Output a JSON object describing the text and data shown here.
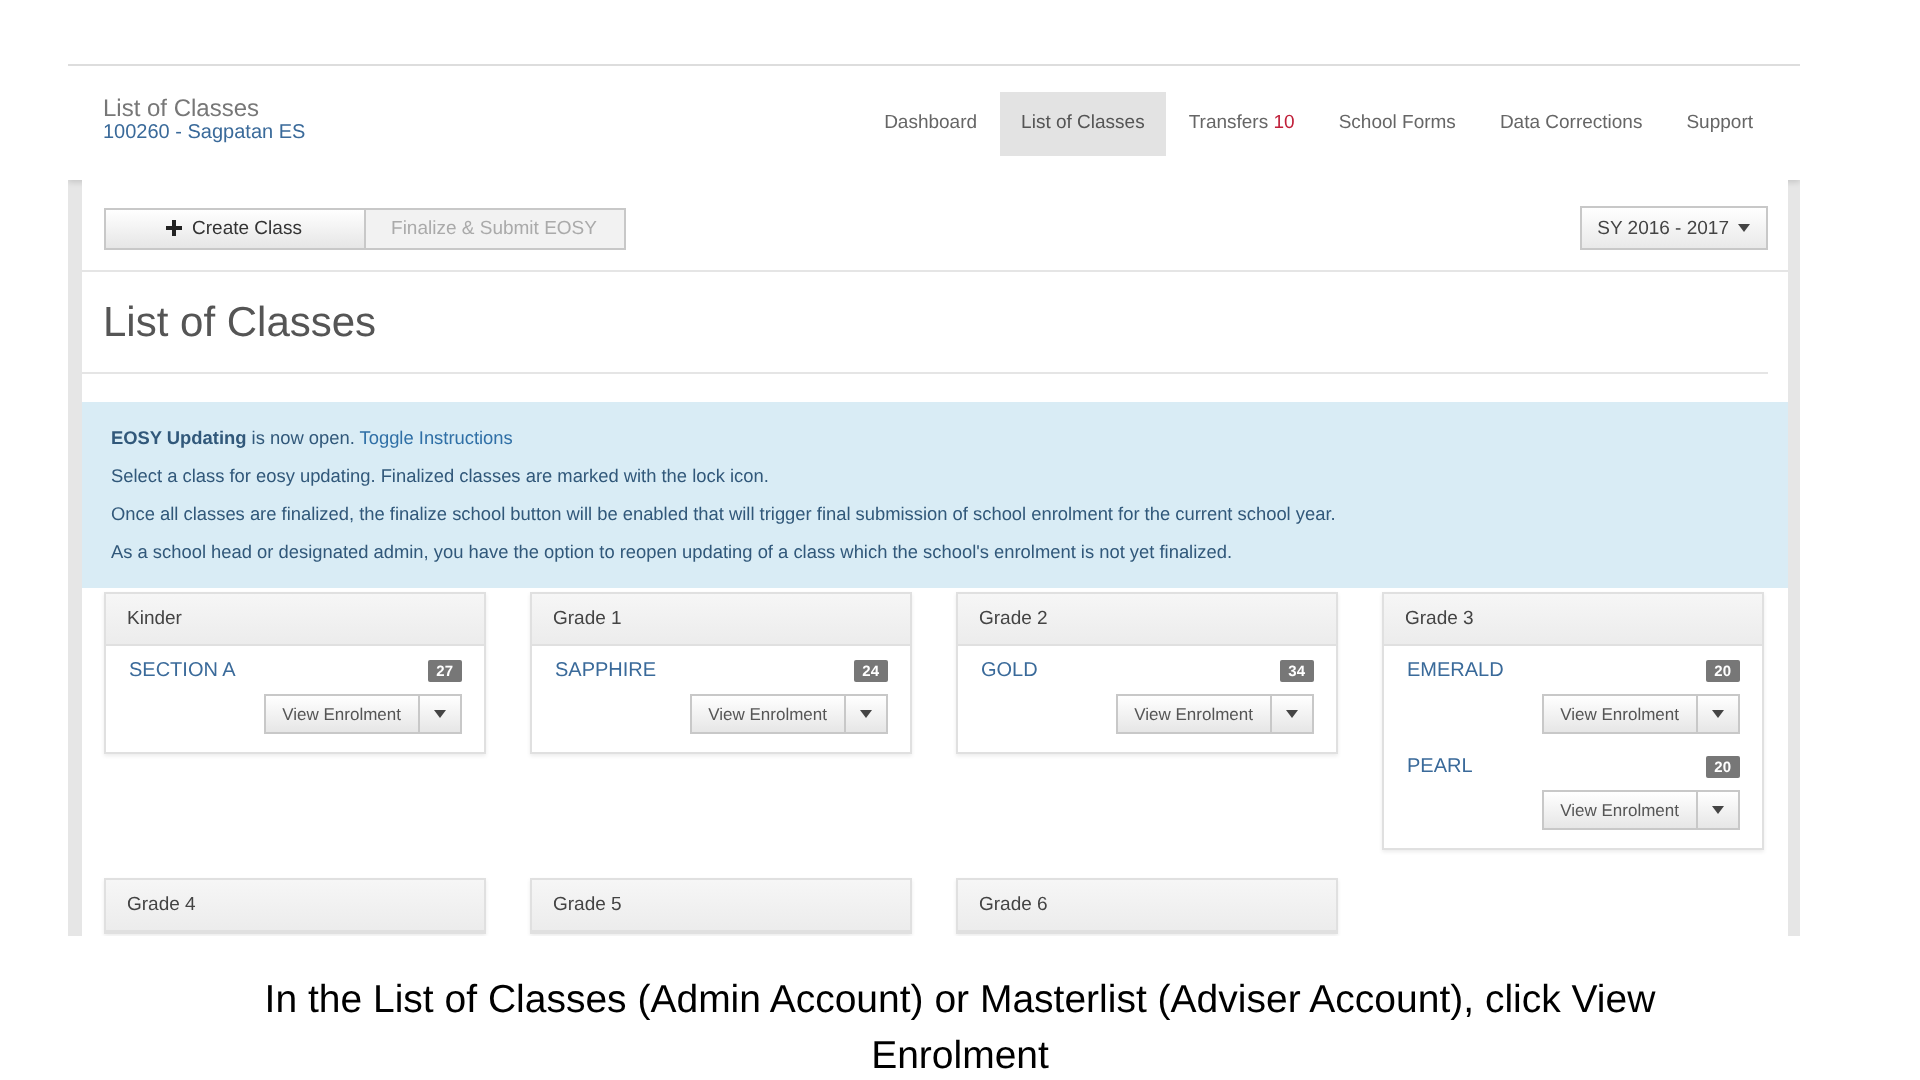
{
  "header": {
    "title": "List of Classes",
    "school": "100260 - Sagpatan ES"
  },
  "nav": [
    {
      "label": "Dashboard",
      "selected": false
    },
    {
      "label": "List of Classes",
      "selected": true
    },
    {
      "label": "Transfers",
      "count": "10",
      "selected": false
    },
    {
      "label": "School Forms",
      "selected": false
    },
    {
      "label": "Data Corrections",
      "selected": false
    },
    {
      "label": "Support",
      "selected": false
    }
  ],
  "toolbar": {
    "buttons": [
      {
        "label": "Create Class",
        "disabled": false
      },
      {
        "label": "Finalize & Submit EOSY",
        "disabled": true
      }
    ],
    "school_year": "SY 2016 - 2017"
  },
  "heading": "List of Classes",
  "alert": {
    "lead": "**EOSY Updating** is now open.",
    "link": "Toggle Instructions",
    "lines": [
      "Select a class for eosy updating. Finalized classes are marked with the lock icon.",
      "Once all classes are finalized, the finalize school button will be enabled that will trigger final submission of school enrolment for the current school year.",
      "As a school head or designated admin, you have the option to reopen updating of a class which the school's enrolment is not yet finalized."
    ]
  },
  "grades": [
    {
      "name": "Kinder",
      "sections": [
        {
          "name": "SECTION A",
          "count": "27",
          "button": "View Enrolment"
        }
      ]
    },
    {
      "name": "Grade 1",
      "sections": [
        {
          "name": "SAPPHIRE",
          "count": "24",
          "button": "View Enrolment"
        }
      ]
    },
    {
      "name": "Grade 2",
      "sections": [
        {
          "name": "GOLD",
          "count": "34",
          "button": "View Enrolment"
        }
      ]
    },
    {
      "name": "Grade 3",
      "sections": [
        {
          "name": "EMERALD",
          "count": "20",
          "button": "View Enrolment"
        },
        {
          "name": "PEARL",
          "count": "20",
          "button": "View Enrolment"
        }
      ]
    },
    {
      "name": "Grade 4"
    },
    {
      "name": "Grade 5"
    },
    {
      "name": "Grade 6"
    }
  ],
  "caption": "In the List of Classes (Admin Account) or Masterlist (Adviser Account), click View Enrolment"
}
